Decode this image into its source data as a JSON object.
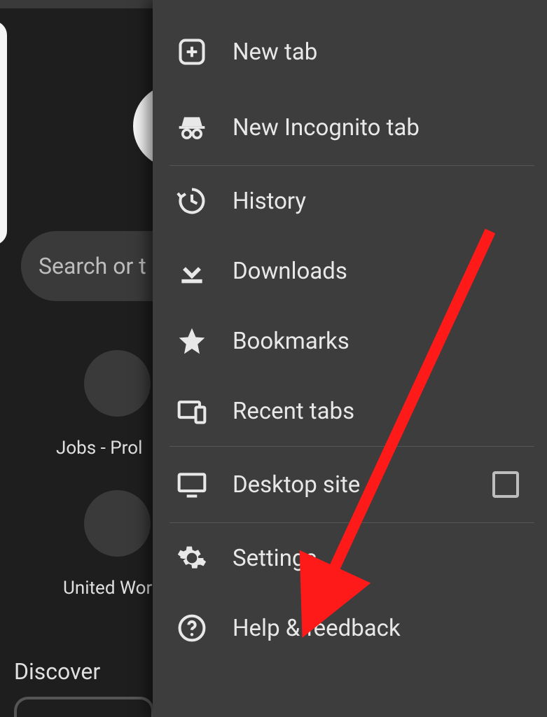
{
  "background": {
    "search_placeholder": "Search or t",
    "tile1_label": "Jobs - Prol",
    "tile2_label": "United Wor",
    "discover_label": "Discover"
  },
  "menu": {
    "items": [
      {
        "id": "new-tab",
        "icon": "plus-box-icon",
        "label": "New tab"
      },
      {
        "id": "incognito",
        "icon": "incognito-icon",
        "label": "New Incognito tab"
      },
      {
        "id": "history",
        "icon": "history-icon",
        "label": "History"
      },
      {
        "id": "downloads",
        "icon": "download-icon",
        "label": "Downloads"
      },
      {
        "id": "bookmarks",
        "icon": "star-icon",
        "label": "Bookmarks"
      },
      {
        "id": "recent-tabs",
        "icon": "devices-icon",
        "label": "Recent tabs"
      },
      {
        "id": "desktop-site",
        "icon": "monitor-icon",
        "label": "Desktop site",
        "checkbox": true
      },
      {
        "id": "settings",
        "icon": "gear-icon",
        "label": "Settings"
      },
      {
        "id": "help",
        "icon": "help-icon",
        "label": "Help & feedback"
      }
    ]
  }
}
